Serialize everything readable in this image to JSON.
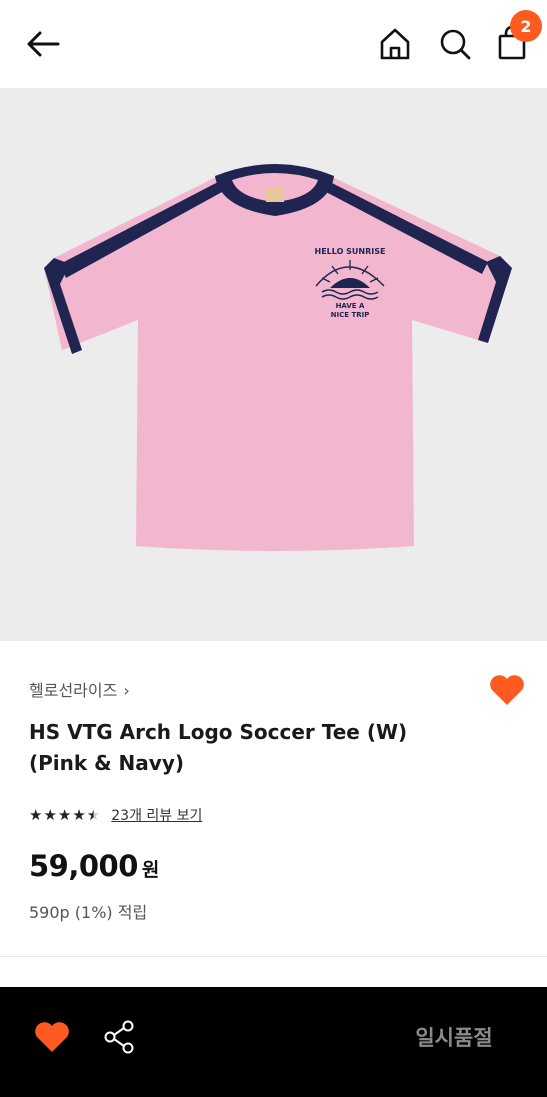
{
  "header": {
    "icons": [
      "arrow-left-icon",
      "home-icon",
      "search-icon",
      "shopping-bag-icon"
    ],
    "cart_count": "2"
  },
  "colors": {
    "accent": "#ff5a1f",
    "image_bg": "#ececec",
    "shirt_pink": "#f2b7cf",
    "shirt_navy": "#1f2450",
    "bottom_bar": "#000000"
  },
  "product": {
    "brand": "헬로선라이즈",
    "brand_chevron": "›",
    "title_line1": "HS VTG Arch Logo Soccer Tee (W)",
    "title_line2": "(Pink & Navy)",
    "rating": 4.5,
    "review_link": "23개 리뷰 보기",
    "price": "59,000",
    "price_unit": "원",
    "points": "590p (1%) 적립",
    "image_print": {
      "arch": "HELLO SUNRISE",
      "line1": "HAVE A",
      "line2": "NICE TRIP"
    }
  },
  "bottom_bar": {
    "status_label": "일시품절"
  }
}
